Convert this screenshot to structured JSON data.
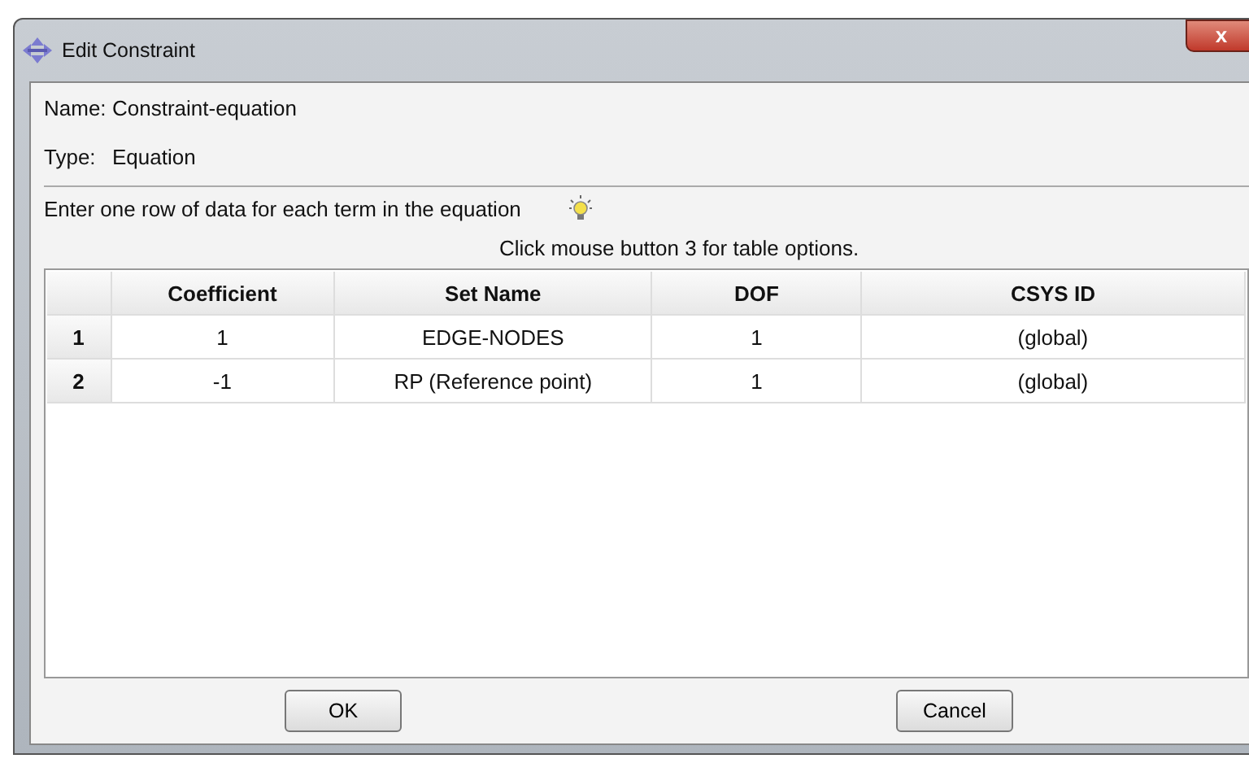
{
  "window": {
    "title": "Edit Constraint",
    "close": "x"
  },
  "fields": [
    {
      "label": "Name:",
      "value": "Constraint-equation"
    },
    {
      "label": "Type:",
      "value": "Equation"
    }
  ],
  "instruction": "Enter one row of data for each term in the equation",
  "table_hint": "Click mouse button 3 for table options.",
  "table": {
    "columns": [
      "Coefficient",
      "Set Name",
      "DOF",
      "CSYS ID"
    ],
    "rows": [
      {
        "number": "1",
        "cells": [
          "1",
          "EDGE-NODES",
          "1",
          "(global)"
        ]
      },
      {
        "number": "2",
        "cells": [
          "-1",
          "RP (Reference point)",
          "1",
          "(global)"
        ]
      }
    ]
  },
  "buttons": [
    "OK",
    "Cancel"
  ]
}
